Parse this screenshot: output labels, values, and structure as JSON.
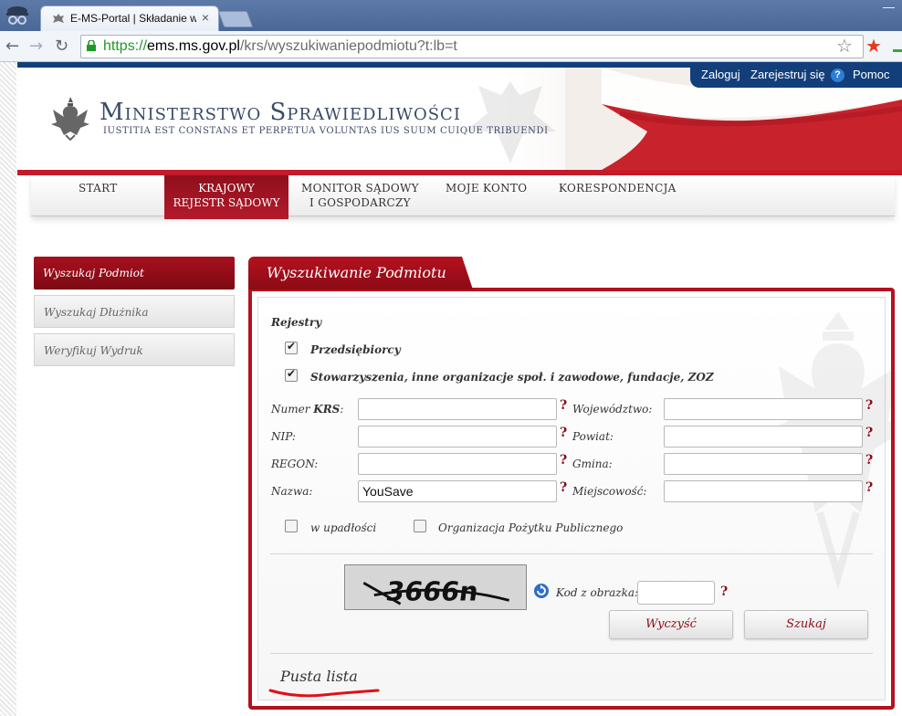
{
  "browser": {
    "tab_title": "E-MS-Portal | Składanie wnio",
    "tab_close": "×",
    "window_control": "—",
    "url_scheme": "https://",
    "url_domain": "ems.ms.gov.pl",
    "url_path": "/krs/wyszukiwaniepodmiotu?t:lb=t"
  },
  "userbar": {
    "login": "Zaloguj",
    "register": "Zarejestruj się",
    "help_mark": "?",
    "help": "Pomoc"
  },
  "header": {
    "title": "Ministerstwo Sprawiedliwości",
    "motto": "IUSTITIA EST CONSTANS ET PERPETUA VOLUNTAS IUS SUUM CUIQUE TRIBUENDI"
  },
  "nav": {
    "start": "START",
    "krs_line1": "KRAJOWY",
    "krs_line2": "REJESTR SĄDOWY",
    "monitor_line1": "MONITOR SĄDOWY",
    "monitor_line2": "I GOSPODARCZY",
    "account": "MOJE KONTO",
    "correspondence": "KORESPONDENCJA"
  },
  "sidebar": {
    "items": [
      {
        "label": "Wyszukaj Podmiot"
      },
      {
        "label": "Wyszukaj Dłużnika"
      },
      {
        "label": "Weryfikuj Wydruk"
      }
    ]
  },
  "panel": {
    "title": "Wyszukiwanie Podmiotu",
    "registers_heading": "Rejestry",
    "reg_entrepreneurs": "Przedsiębiorcy",
    "reg_associations": "Stowarzyszenia, inne organizacje społ. i zawodowe, fundacje, ZOZ",
    "reg_entrepreneurs_checked": true,
    "reg_associations_checked": true,
    "fields": {
      "krs_label_prefix": "Numer ",
      "krs_label_bold": "KRS",
      "krs_label_suffix": ":",
      "nip_label": "NIP:",
      "regon_label": "REGON:",
      "name_label": "Nazwa:",
      "name_value": "YouSave",
      "voivodeship_label": "Województwo:",
      "county_label": "Powiat:",
      "commune_label": "Gmina:",
      "locality_label": "Miejscowość:"
    },
    "help_mark": "?",
    "bankruptcy_label": "w upadłości",
    "opp_label": "Organizacja Pożytku Publicznego",
    "captcha_text": "3666n",
    "captcha_label": "Kod z obrazka:",
    "clear_button": "Wyczyść",
    "search_button": "Szukaj",
    "empty_list": "Pusta lista"
  }
}
